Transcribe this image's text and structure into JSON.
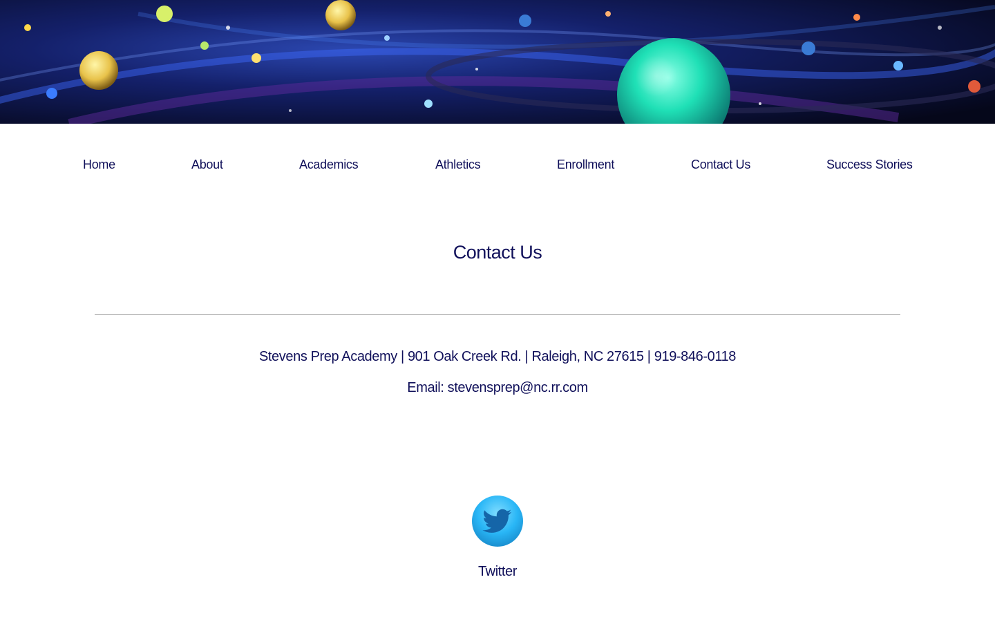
{
  "banner": {
    "image": "space-planets-banner",
    "colors": [
      "#07091d",
      "#1b2b7a",
      "#ffd84a",
      "#1de0b0"
    ]
  },
  "nav": {
    "items": [
      {
        "label": "Home"
      },
      {
        "label": "About"
      },
      {
        "label": "Academics"
      },
      {
        "label": "Athletics"
      },
      {
        "label": "Enrollment"
      },
      {
        "label": "Contact Us"
      },
      {
        "label": "Success Stories"
      }
    ]
  },
  "main": {
    "title": "Contact Us",
    "address_line": "Stevens Prep Academy | 901 Oak Creek Rd. | Raleigh, NC 27615 | 919-846-0118",
    "email_prefix": "Email: ",
    "email": "stevensprep@nc.rr.com"
  },
  "social": {
    "icon": "twitter-icon",
    "label": "Twitter"
  },
  "colors": {
    "text": "#10105a",
    "divider": "#9a9a9a",
    "twitter": "#29b6f6"
  }
}
